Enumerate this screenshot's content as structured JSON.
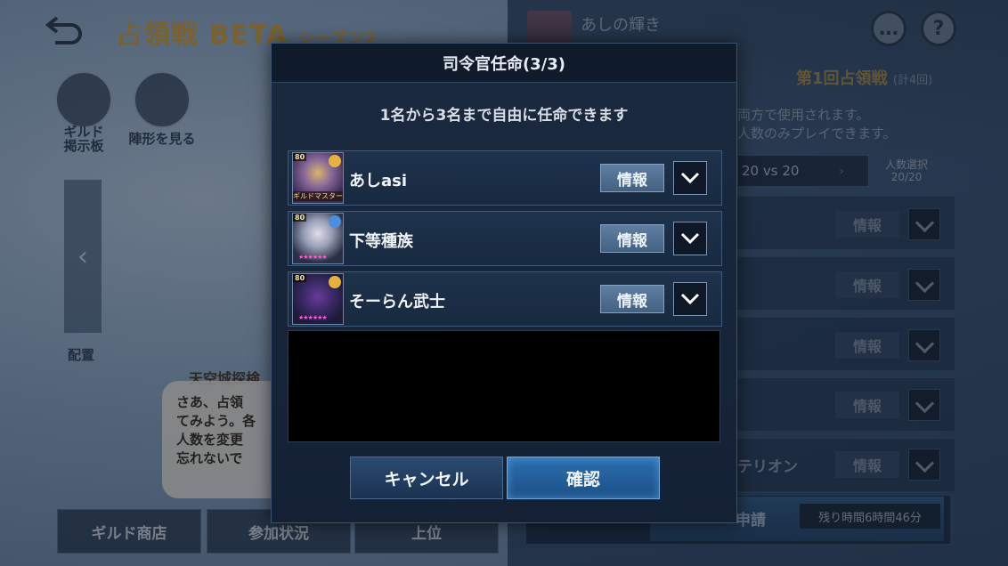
{
  "background": {
    "title_main": "占領戦 BETA",
    "title_season": "シーズン2",
    "guild_name": "あしの輝き",
    "round_title": "第1回占領戦",
    "round_total": "(計4回)",
    "info_line_1": "両方で使用されます。",
    "info_line_2": "人数のみプレイできます。",
    "vs_text": "20 vs 20",
    "people_select_label": "人数選択",
    "people_select_value": "20/20",
    "row_info_label": "情報",
    "partial_row_label": "テリオン",
    "apply_label": "申請",
    "remaining_time": "残り時間6時間46分",
    "side_buttons": [
      {
        "label": "ギルド\n掲示板"
      },
      {
        "label": "陣形を見る"
      }
    ],
    "formation_label": "配置",
    "speech_title": "天空城探検",
    "speech_lines": [
      "さあ、占領",
      "てみよう。各",
      "人数を変更",
      "忘れないで"
    ],
    "bottom_buttons": [
      "ギルド商店",
      "参加状況",
      "上位"
    ]
  },
  "modal": {
    "title": "司令官任命(3/3)",
    "subtitle": "1名から3名まで自由に任命できます",
    "info_label": "情報",
    "cancel_label": "キャンセル",
    "confirm_label": "確認",
    "commanders": [
      {
        "name": "あしasi",
        "level": "80",
        "role": "ギルドマスター",
        "accent": "#e6b23a",
        "has_stars": false,
        "stars": "",
        "portrait_colors": [
          "#3a2a55",
          "#d9b66a"
        ]
      },
      {
        "name": "下等種族",
        "level": "80",
        "role": "",
        "accent": "#4a8fe0",
        "has_stars": true,
        "stars": "★★★★★★",
        "portrait_colors": [
          "#2a2f45",
          "#bfc4d6"
        ]
      },
      {
        "name": "そーらん武士",
        "level": "80",
        "role": "",
        "accent": "#e6b23a",
        "has_stars": true,
        "stars": "★★★★★★",
        "portrait_colors": [
          "#1f1a3a",
          "#6a3a9a"
        ]
      }
    ]
  },
  "colors": {
    "accent_gold": "#d4a43a",
    "confirm_blue": "#2c6fb0",
    "panel_dark": "#142135"
  }
}
